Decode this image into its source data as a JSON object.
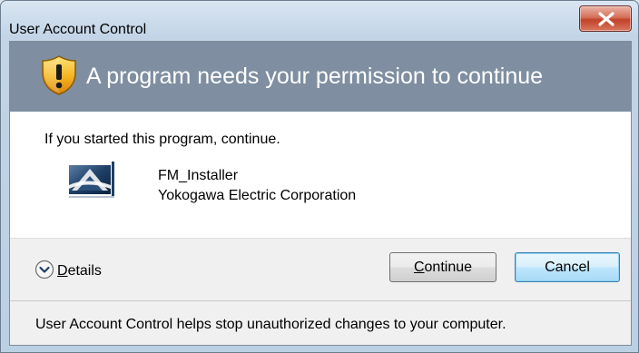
{
  "window": {
    "title": "User Account Control",
    "close_icon": "close-icon"
  },
  "banner": {
    "icon": "shield-warning-icon",
    "heading": "A program needs your permission to continue"
  },
  "content": {
    "prompt": "If you started this program, continue.",
    "program": {
      "icon": "program-icon",
      "name": "FM_Installer",
      "publisher": "Yokogawa Electric Corporation"
    }
  },
  "actions": {
    "details": {
      "icon": "chevron-down-icon",
      "accesskey": "D",
      "rest": "etails"
    },
    "continue_button": {
      "accesskey": "C",
      "rest": "ontinue"
    },
    "cancel_button": {
      "label": "Cancel"
    }
  },
  "footer": {
    "text": "User Account Control helps stop unauthorized changes to your computer."
  },
  "colors": {
    "banner": "#7f8fa1",
    "close_button": "#c24228",
    "default_button": "#bee6fd"
  }
}
